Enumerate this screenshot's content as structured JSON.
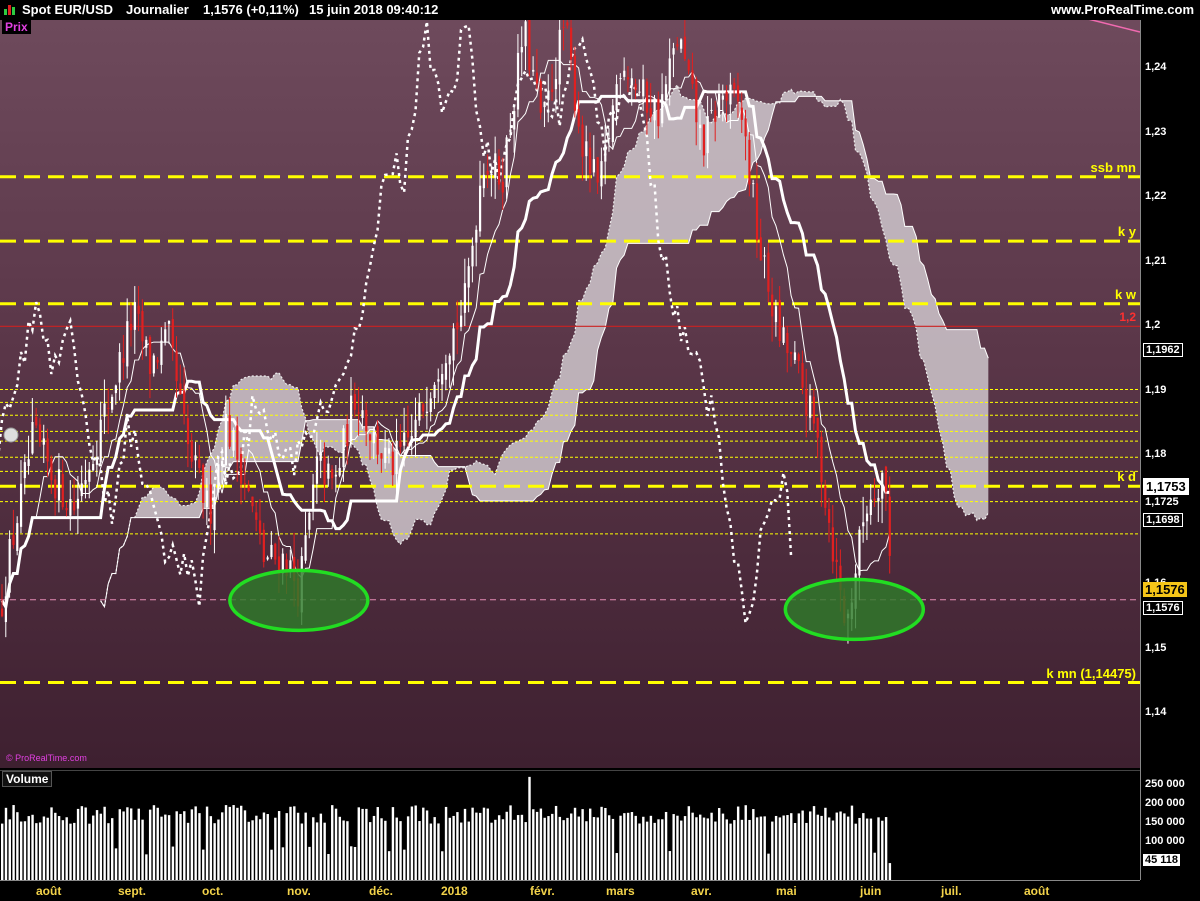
{
  "header": {
    "symbol": "Spot EUR/USD",
    "period": "Journalier",
    "last": "1,1576 (+0,11%)",
    "datetime": "15 juin 2018 09:40:12",
    "website": "www.ProRealTime.com"
  },
  "panels": {
    "price_label": "Prix",
    "volume_label": "Volume",
    "copyright": "© ProRealTime.com"
  },
  "colors": {
    "up": "#ffffff",
    "down": "#e02020",
    "level": "#ffff00",
    "cloud": "#cfc7cc",
    "circle": "#22dd22",
    "red_level": "#cc2222"
  },
  "chart_data": [
    {
      "type": "candlestick",
      "title": "Spot EUR/USD — Journalier",
      "x_ticks": [
        "août",
        "sept.",
        "oct.",
        "nov.",
        "déc.",
        "2018",
        "févr.",
        "mars",
        "avr.",
        "mai",
        "juin",
        "juil.",
        "août"
      ],
      "y_ticks": [
        "1,24",
        "1,23",
        "1,22",
        "1,21",
        "1,2",
        "1,19",
        "1,18",
        "1,17",
        "1,16",
        "1,15",
        "1,14"
      ],
      "ylim": [
        1.1315,
        1.2475
      ],
      "path": [
        [
          "2017-07-17",
          1.146
        ],
        [
          "2017-07-24",
          1.164
        ],
        [
          "2017-08-02",
          1.183
        ],
        [
          "2017-08-10",
          1.176
        ],
        [
          "2017-08-17",
          1.172
        ],
        [
          "2017-08-25",
          1.182
        ],
        [
          "2017-08-31",
          1.19
        ],
        [
          "2017-09-08",
          1.202
        ],
        [
          "2017-09-14",
          1.194
        ],
        [
          "2017-09-21",
          1.198
        ],
        [
          "2017-09-28",
          1.181
        ],
        [
          "2017-10-06",
          1.171
        ],
        [
          "2017-10-12",
          1.185
        ],
        [
          "2017-10-18",
          1.178
        ],
        [
          "2017-10-26",
          1.164
        ],
        [
          "2017-11-03",
          1.164
        ],
        [
          "2017-11-08",
          1.159
        ],
        [
          "2017-11-15",
          1.179
        ],
        [
          "2017-11-21",
          1.175
        ],
        [
          "2017-11-29",
          1.19
        ],
        [
          "2017-12-05",
          1.183
        ],
        [
          "2017-12-12",
          1.178
        ],
        [
          "2017-12-20",
          1.183
        ],
        [
          "2017-12-28",
          1.193
        ],
        [
          "2018-01-08",
          1.203
        ],
        [
          "2018-01-15",
          1.226
        ],
        [
          "2018-01-22",
          1.223
        ],
        [
          "2018-01-30",
          1.246
        ],
        [
          "2018-02-06",
          1.231
        ],
        [
          "2018-02-14",
          1.247
        ],
        [
          "2018-02-21",
          1.227
        ],
        [
          "2018-02-27",
          1.221
        ],
        [
          "2018-03-07",
          1.242
        ],
        [
          "2018-03-14",
          1.236
        ],
        [
          "2018-03-21",
          1.233
        ],
        [
          "2018-03-28",
          1.245
        ],
        [
          "2018-04-06",
          1.228
        ],
        [
          "2018-04-13",
          1.236
        ],
        [
          "2018-04-20",
          1.234
        ],
        [
          "2018-04-27",
          1.212
        ],
        [
          "2018-05-04",
          1.199
        ],
        [
          "2018-05-11",
          1.193
        ],
        [
          "2018-05-18",
          1.183
        ],
        [
          "2018-05-24",
          1.166
        ],
        [
          "2018-05-29",
          1.153
        ],
        [
          "2018-06-05",
          1.172
        ],
        [
          "2018-06-12",
          1.178
        ],
        [
          "2018-06-15",
          1.158
        ]
      ],
      "levels": [
        {
          "label": "ssb mn",
          "value": 1.2232,
          "style": "dashed-thick"
        },
        {
          "label": "k y",
          "value": 1.2132,
          "style": "dashed-thick"
        },
        {
          "label": "k w",
          "value": 1.2035,
          "style": "dashed-thick"
        },
        {
          "label": "1,2",
          "value": 1.2,
          "style": "solid-red"
        },
        {
          "label": "k d",
          "value": 1.1752,
          "style": "dashed-thick"
        },
        {
          "label": "k mn (1,14475)",
          "value": 1.14475,
          "style": "dashed-thick"
        }
      ],
      "thin_levels": [
        1.1902,
        1.1882,
        1.1862,
        1.1837,
        1.1822,
        1.1797,
        1.1775,
        1.1728,
        1.1678
      ],
      "pink_level": 1.1576,
      "annotations": [
        {
          "shape": "ellipse",
          "date": "2017-11-08",
          "value": 1.1575
        },
        {
          "shape": "ellipse",
          "date": "2018-06-01",
          "value": 1.1561
        }
      ],
      "price_tags": [
        {
          "value": "1,1962",
          "y": 1.1962,
          "bg": "#000000",
          "fg": "#ffffff",
          "border": "#ffffff"
        },
        {
          "value": "1,1753",
          "y": 1.1753,
          "bg": "#ffffff",
          "fg": "#000000",
          "border": "#ffffff"
        },
        {
          "value": "1,1725",
          "y": 1.1725,
          "bg": "#000000",
          "fg": "#ffffff",
          "border": "none"
        },
        {
          "value": "1,1698",
          "y": 1.1698,
          "bg": "#000000",
          "fg": "#ffffff",
          "border": "#ffffff"
        },
        {
          "value": "1,1576",
          "y": 1.1591,
          "bg": "#f5c518",
          "fg": "#000000",
          "border": "none"
        },
        {
          "value": "1,1576",
          "y": 1.1561,
          "bg": "#000000",
          "fg": "#ffffff",
          "border": "#ffffff"
        }
      ]
    },
    {
      "type": "bar",
      "title": "Volume",
      "y_ticks": [
        "250 000",
        "200 000",
        "150 000",
        "100 000",
        "50 000"
      ],
      "ylim": [
        0,
        280000
      ],
      "last_value": "45 118",
      "last_value_y": 45118,
      "typical_range": [
        150000,
        200000
      ],
      "max": 275000
    }
  ]
}
